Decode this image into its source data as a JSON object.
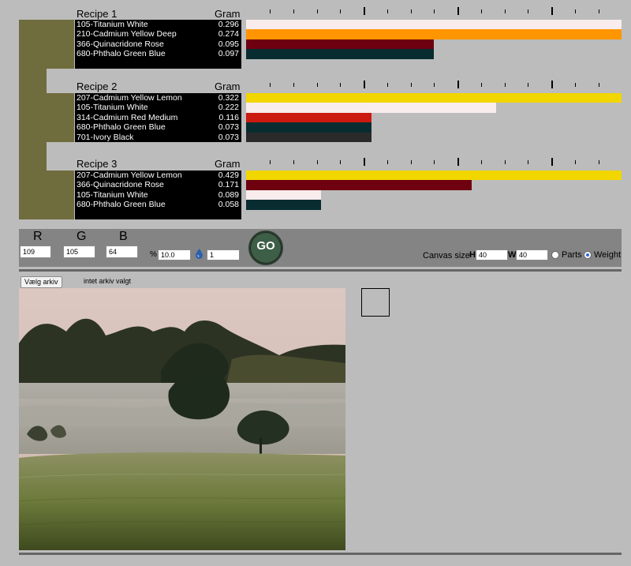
{
  "colors": {
    "swatch": "#6f6c3e",
    "titanium_white": "#f8ecec",
    "cadmium_yellow_deep": "#ff9500",
    "quinacridone_rose": "#6e0010",
    "phthalo_green_blue": "#082c30",
    "cadmium_yellow_lemon": "#f1d600",
    "cadmium_red_medium": "#cb1a10",
    "ivory_black": "#2a2a2a"
  },
  "recipes": [
    {
      "title": "Recipe 1",
      "gram_label": "Gram",
      "items": [
        {
          "name": "105-Titanium White",
          "value": "0.296",
          "fraction": 0.296,
          "color": "#f8ecec"
        },
        {
          "name": "210-Cadmium Yellow Deep",
          "value": "0.274",
          "fraction": 0.274,
          "color": "#ff9500"
        },
        {
          "name": "366-Quinacridone Rose",
          "value": "0.095",
          "fraction": 0.095,
          "color": "#6e0010"
        },
        {
          "name": "680-Phthalo Green Blue",
          "value": "0.097",
          "fraction": 0.097,
          "color": "#082c30"
        }
      ],
      "bar_fractions": [
        1.0,
        1.0,
        0.5,
        0.5
      ]
    },
    {
      "title": "Recipe 2",
      "gram_label": "Gram",
      "items": [
        {
          "name": "207-Cadmium Yellow Lemon",
          "value": "0.322",
          "color": "#f1d600"
        },
        {
          "name": "105-Titanium White",
          "value": "0.222",
          "color": "#f8ecec"
        },
        {
          "name": "314-Cadmium Red Medium",
          "value": "0.116",
          "color": "#cb1a10"
        },
        {
          "name": "680-Phthalo Green Blue",
          "value": "0.073",
          "color": "#082c30"
        },
        {
          "name": "701-Ivory Black",
          "value": "0.073",
          "color": "#2a2a2a"
        }
      ],
      "bar_fractions": [
        1.0,
        0.667,
        0.333,
        0.333,
        0.333
      ]
    },
    {
      "title": "Recipe 3",
      "gram_label": "Gram",
      "items": [
        {
          "name": "207-Cadmium Yellow Lemon",
          "value": "0.429",
          "color": "#f1d600"
        },
        {
          "name": "366-Quinacridone Rose",
          "value": "0.171",
          "color": "#6e0010"
        },
        {
          "name": "105-Titanium White",
          "value": "0.089",
          "color": "#f8ecec"
        },
        {
          "name": "680-Phthalo Green Blue",
          "value": "0.058",
          "color": "#082c30"
        }
      ],
      "bar_fractions": [
        1.0,
        0.6,
        0.2,
        0.2
      ]
    }
  ],
  "controls": {
    "r_label": "R",
    "g_label": "G",
    "b_label": "B",
    "r_value": "109",
    "g_value": "105",
    "b_value": "64",
    "percent_label": "%",
    "percent_value": "10.0",
    "drop_value": "1",
    "go_label": "GO",
    "canvas_label": "Canvas size",
    "h_label": "H",
    "h_value": "40",
    "w_label": "W",
    "w_value": "40",
    "parts_label": "Parts",
    "weight_label": "Weight",
    "selected_mode": "Weight"
  },
  "file": {
    "button_label": "Vælg arkiv",
    "status": "intet arkiv valgt"
  }
}
